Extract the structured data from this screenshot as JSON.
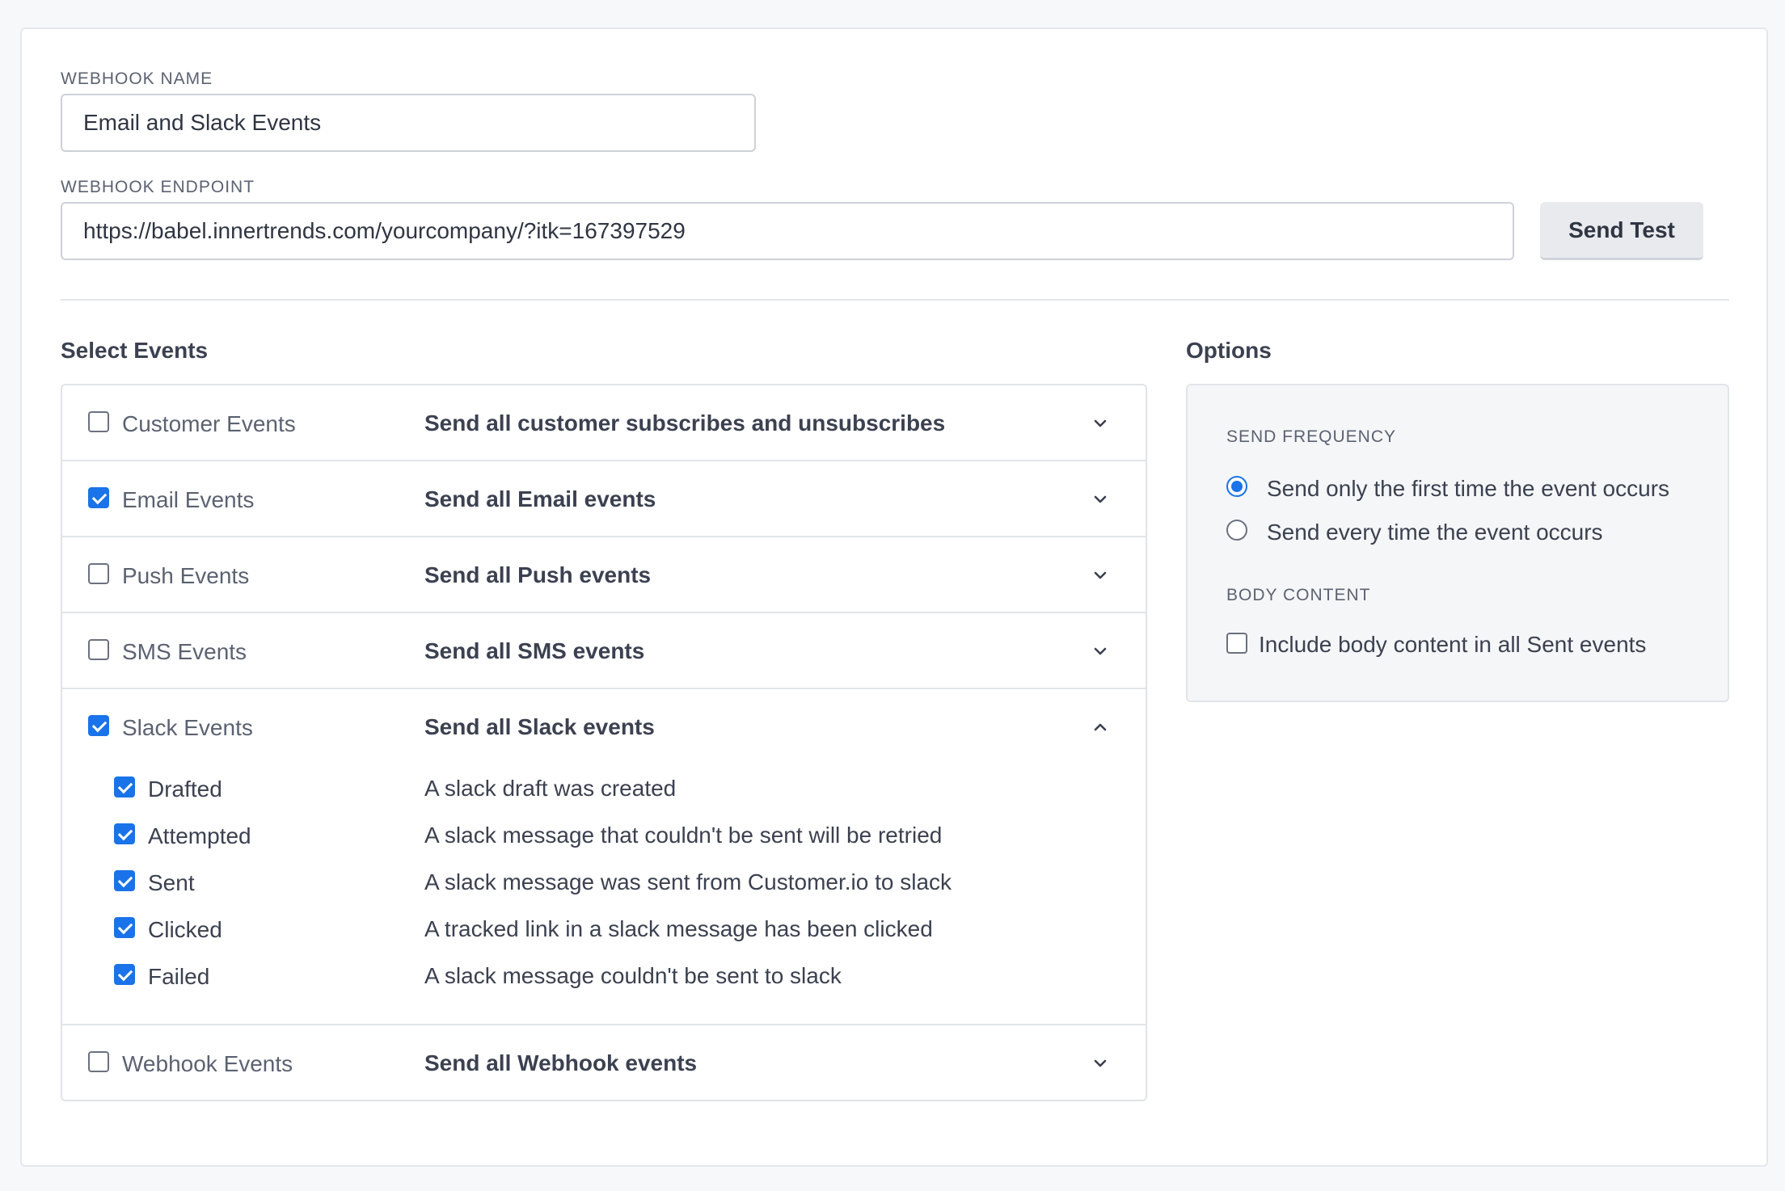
{
  "form": {
    "name_label": "WEBHOOK NAME",
    "name_value": "Email and Slack Events",
    "endpoint_label": "WEBHOOK ENDPOINT",
    "endpoint_value": "https://babel.innertrends.com/yourcompany/?itk=167397529",
    "send_test_label": "Send Test"
  },
  "events": {
    "title": "Select Events",
    "rows": [
      {
        "name": "Customer Events",
        "description": "Send all customer subscribes and unsubscribes",
        "checked": false,
        "expanded": false
      },
      {
        "name": "Email Events",
        "description": "Send all Email events",
        "checked": true,
        "expanded": false
      },
      {
        "name": "Push Events",
        "description": "Send all Push events",
        "checked": false,
        "expanded": false
      },
      {
        "name": "SMS Events",
        "description": "Send all SMS events",
        "checked": false,
        "expanded": false
      },
      {
        "name": "Slack Events",
        "description": "Send all Slack events",
        "checked": true,
        "expanded": true
      },
      {
        "name": "Webhook Events",
        "description": "Send all Webhook events",
        "checked": false,
        "expanded": false
      }
    ],
    "slack_sub": [
      {
        "name": "Drafted",
        "description": "A slack draft was created",
        "checked": true
      },
      {
        "name": "Attempted",
        "description": "A slack message that couldn't be sent will be retried",
        "checked": true
      },
      {
        "name": "Sent",
        "description": "A slack message was sent from Customer.io to slack",
        "checked": true
      },
      {
        "name": "Clicked",
        "description": "A tracked link in a slack message has been clicked",
        "checked": true
      },
      {
        "name": "Failed",
        "description": "A slack message couldn't be sent to slack",
        "checked": true
      }
    ]
  },
  "options": {
    "title": "Options",
    "frequency_label": "SEND FREQUENCY",
    "frequency_first": "Send only the first time the event occurs",
    "frequency_every": "Send every time the event occurs",
    "frequency_selected": "first",
    "body_label": "BODY CONTENT",
    "body_option": "Include body content in all Sent events",
    "body_checked": false
  },
  "colors": {
    "accent": "#1a73e8",
    "text": "#3b4150",
    "muted": "#5b6271",
    "border": "#e1e4e9"
  }
}
